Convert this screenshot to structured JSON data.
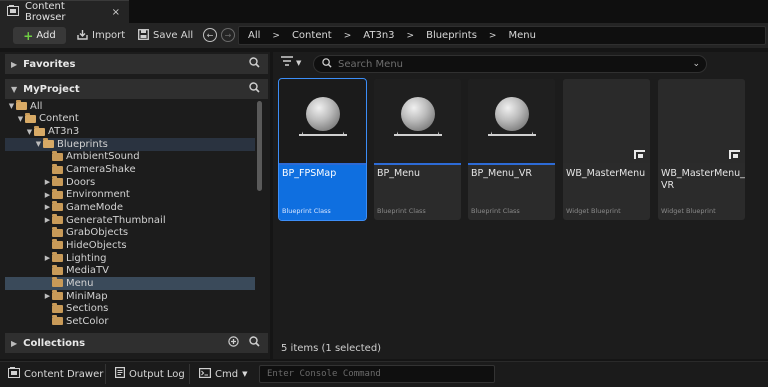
{
  "window": {
    "tab_title": "Content Browser",
    "close_glyph": "×"
  },
  "toolbar": {
    "add_label": "Add",
    "import_label": "Import",
    "save_all_label": "Save All"
  },
  "breadcrumb": [
    "All",
    "Content",
    "AT3n3",
    "Blueprints",
    "Menu"
  ],
  "sources": {
    "favorites_label": "Favorites",
    "project_label": "MyProject",
    "collections_label": "Collections"
  },
  "tree": [
    {
      "label": "All",
      "depth": 0,
      "expanded": true,
      "has_children": true
    },
    {
      "label": "Content",
      "depth": 1,
      "expanded": true,
      "has_children": true
    },
    {
      "label": "AT3n3",
      "depth": 2,
      "expanded": true,
      "has_children": true
    },
    {
      "label": "Blueprints",
      "depth": 3,
      "expanded": true,
      "has_children": true,
      "highlighted": true
    },
    {
      "label": "AmbientSound",
      "depth": 4,
      "has_children": false
    },
    {
      "label": "CameraShake",
      "depth": 4,
      "has_children": false
    },
    {
      "label": "Doors",
      "depth": 4,
      "has_children": true
    },
    {
      "label": "Environment",
      "depth": 4,
      "has_children": true
    },
    {
      "label": "GameMode",
      "depth": 4,
      "has_children": true
    },
    {
      "label": "GenerateThumbnail",
      "depth": 4,
      "has_children": true
    },
    {
      "label": "GrabObjects",
      "depth": 4,
      "has_children": false
    },
    {
      "label": "HideObjects",
      "depth": 4,
      "has_children": false
    },
    {
      "label": "Lighting",
      "depth": 4,
      "has_children": true
    },
    {
      "label": "MediaTV",
      "depth": 4,
      "has_children": false
    },
    {
      "label": "Menu",
      "depth": 4,
      "has_children": false,
      "selected": true
    },
    {
      "label": "MiniMap",
      "depth": 4,
      "has_children": true
    },
    {
      "label": "Sections",
      "depth": 4,
      "has_children": false
    },
    {
      "label": "SetColor",
      "depth": 4,
      "has_children": false
    }
  ],
  "search": {
    "placeholder": "Search Menu"
  },
  "assets": [
    {
      "name": "BP_FPSMap",
      "type": "Blueprint Class",
      "kind": "blueprint",
      "selected": true
    },
    {
      "name": "BP_Menu",
      "type": "Blueprint Class",
      "kind": "blueprint"
    },
    {
      "name": "BP_Menu_VR",
      "type": "Blueprint Class",
      "kind": "blueprint"
    },
    {
      "name": "WB_MasterMenu",
      "type": "Widget Blueprint",
      "kind": "widget"
    },
    {
      "name": "WB_MasterMenu_\nVR",
      "type": "Widget Blueprint",
      "kind": "widget"
    }
  ],
  "status": {
    "items_count": "5 items (1 selected)",
    "content_drawer_label": "Content Drawer",
    "output_log_label": "Output Log",
    "cmd_label": "Cmd",
    "console_placeholder": "Enter Console Command"
  },
  "colors": {
    "accent_blue": "#0f6fe0",
    "folder": "#c89a58",
    "add_green": "#6fcf43"
  }
}
